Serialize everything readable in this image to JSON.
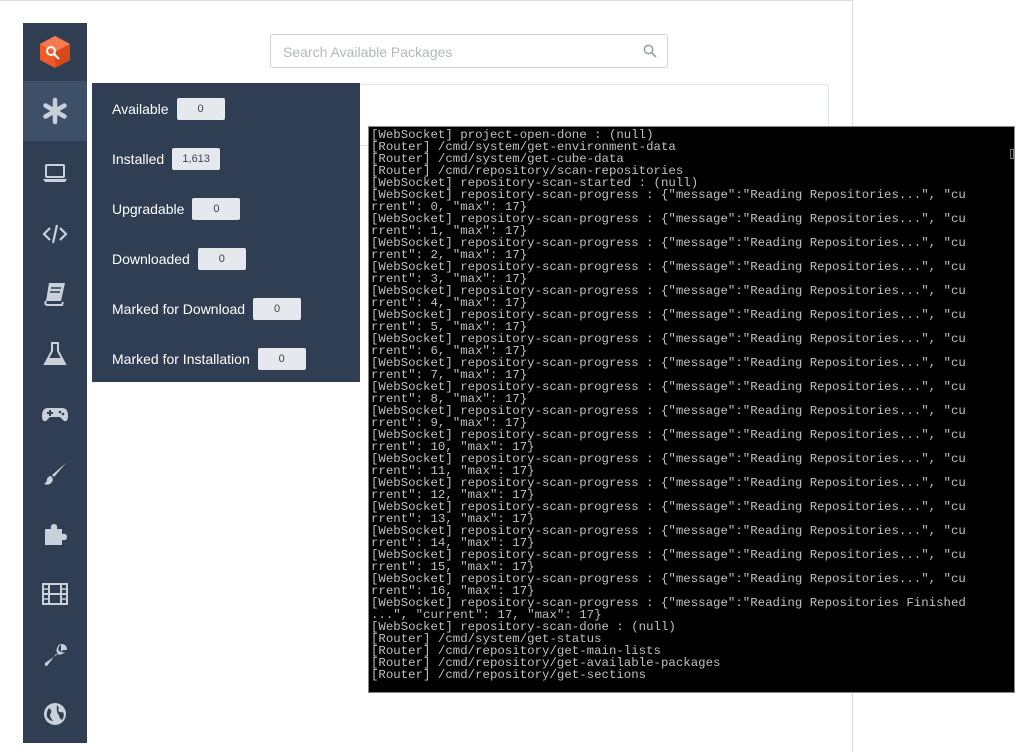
{
  "app": {
    "search": {
      "placeholder": "Search Available Packages"
    }
  },
  "sidebar": {
    "logo_icon": "orange-cube-key-logo",
    "items": [
      {
        "name": "asterisk-icon",
        "active": true
      },
      {
        "name": "laptop-icon"
      },
      {
        "name": "code-icon"
      },
      {
        "name": "book-icon"
      },
      {
        "name": "flask-icon"
      },
      {
        "name": "gamepad-icon"
      },
      {
        "name": "paintbrush-icon"
      },
      {
        "name": "puzzle-piece-icon"
      },
      {
        "name": "film-icon"
      },
      {
        "name": "wrench-icon"
      },
      {
        "name": "globe-icon"
      }
    ]
  },
  "filters": [
    {
      "label": "Available",
      "count": "0"
    },
    {
      "label": "Installed",
      "count": "1,613"
    },
    {
      "label": "Upgradable",
      "count": "0"
    },
    {
      "label": "Downloaded",
      "count": "0"
    },
    {
      "label": "Marked for Download",
      "count": "0"
    },
    {
      "label": "Marked for Installation",
      "count": "0"
    }
  ],
  "console": {
    "lines": [
      "[WebSocket] project-open-done : (null)",
      "[Router] /cmd/system/get-environment-data",
      "[Router] /cmd/system/get-cube-data",
      "[Router] /cmd/repository/scan-repositories",
      "[WebSocket] repository-scan-started : (null)",
      "[WebSocket] repository-scan-progress : {\"message\":\"Reading Repositories...\", \"cu",
      "rrent\": 0, \"max\": 17}",
      "[WebSocket] repository-scan-progress : {\"message\":\"Reading Repositories...\", \"cu",
      "rrent\": 1, \"max\": 17}",
      "[WebSocket] repository-scan-progress : {\"message\":\"Reading Repositories...\", \"cu",
      "rrent\": 2, \"max\": 17}",
      "[WebSocket] repository-scan-progress : {\"message\":\"Reading Repositories...\", \"cu",
      "rrent\": 3, \"max\": 17}",
      "[WebSocket] repository-scan-progress : {\"message\":\"Reading Repositories...\", \"cu",
      "rrent\": 4, \"max\": 17}",
      "[WebSocket] repository-scan-progress : {\"message\":\"Reading Repositories...\", \"cu",
      "rrent\": 5, \"max\": 17}",
      "[WebSocket] repository-scan-progress : {\"message\":\"Reading Repositories...\", \"cu",
      "rrent\": 6, \"max\": 17}",
      "[WebSocket] repository-scan-progress : {\"message\":\"Reading Repositories...\", \"cu",
      "rrent\": 7, \"max\": 17}",
      "[WebSocket] repository-scan-progress : {\"message\":\"Reading Repositories...\", \"cu",
      "rrent\": 8, \"max\": 17}",
      "[WebSocket] repository-scan-progress : {\"message\":\"Reading Repositories...\", \"cu",
      "rrent\": 9, \"max\": 17}",
      "[WebSocket] repository-scan-progress : {\"message\":\"Reading Repositories...\", \"cu",
      "rrent\": 10, \"max\": 17}",
      "[WebSocket] repository-scan-progress : {\"message\":\"Reading Repositories...\", \"cu",
      "rrent\": 11, \"max\": 17}",
      "[WebSocket] repository-scan-progress : {\"message\":\"Reading Repositories...\", \"cu",
      "rrent\": 12, \"max\": 17}",
      "[WebSocket] repository-scan-progress : {\"message\":\"Reading Repositories...\", \"cu",
      "rrent\": 13, \"max\": 17}",
      "[WebSocket] repository-scan-progress : {\"message\":\"Reading Repositories...\", \"cu",
      "rrent\": 14, \"max\": 17}",
      "[WebSocket] repository-scan-progress : {\"message\":\"Reading Repositories...\", \"cu",
      "rrent\": 15, \"max\": 17}",
      "[WebSocket] repository-scan-progress : {\"message\":\"Reading Repositories...\", \"cu",
      "rrent\": 16, \"max\": 17}",
      "[WebSocket] repository-scan-progress : {\"message\":\"Reading Repositories Finished",
      "...\", \"current\": 17, \"max\": 17}",
      "[WebSocket] repository-scan-done : (null)",
      "[Router] /cmd/system/get-status",
      "[Router] /cmd/repository/get-main-lists",
      "[Router] /cmd/repository/get-available-packages",
      "[Router] /cmd/repository/get-sections"
    ]
  },
  "colors": {
    "sidebar": "#2f3e52",
    "sidebar_active": "#3e5068",
    "logo_orange": "#f05a28",
    "console_bg": "#000000",
    "console_text": "#c0c0c0"
  }
}
